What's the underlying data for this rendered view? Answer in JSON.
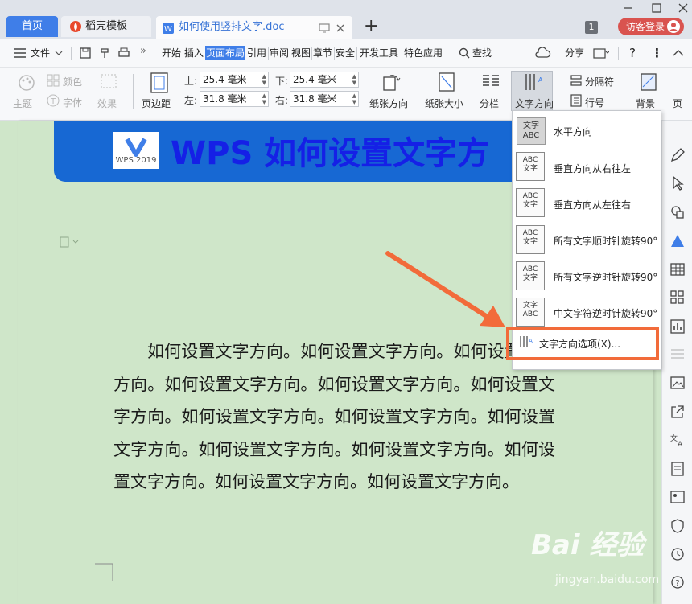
{
  "tabs": {
    "home": "首页",
    "template": "稻壳模板",
    "doc": "如何使用竖排文字.doc",
    "add": "+"
  },
  "window": {
    "badge": "1",
    "login": "访客登录"
  },
  "menu": {
    "file": "文件",
    "items": [
      "开始",
      "插入",
      "页面布局",
      "引用",
      "审阅",
      "视图",
      "章节",
      "安全",
      "开发工具",
      "特色应用"
    ],
    "search": "查找",
    "share": "分享",
    "help": "?"
  },
  "ribbon": {
    "theme": "主题",
    "color": "颜色",
    "font": "字体",
    "effect": "效果",
    "margin": "页边距",
    "top_label": "上:",
    "top_value": "25.4 毫米",
    "bottom_label": "下:",
    "bottom_value": "25.4 毫米",
    "left_label": "左:",
    "left_value": "31.8 毫米",
    "right_label": "右:",
    "right_value": "31.8 毫米",
    "orientation": "纸张方向",
    "size": "纸张大小",
    "columns": "分栏",
    "text_direction": "文字方向",
    "separator": "分隔符",
    "line_number": "行号",
    "background": "背景",
    "page": "页"
  },
  "document": {
    "logo_text": "WPS 2019",
    "banner_title": "WPS 如何设置文字方",
    "paragraph": "如何设置文字方向。如何设置文字方向。如何设置文字方向。如何设置文字方向。如何设置文字方向。如何设置文字方向。如何设置文字方向。如何设置文字方向。如何设置文字方向。如何设置文字方向。如何设置文字方向。如何设置文字方向。如何设置文字方向。如何设置文字方向。"
  },
  "dropdown": {
    "items": [
      {
        "label": "水平方向",
        "icon": "文字ABC"
      },
      {
        "label": "垂直方向从右往左",
        "icon": "ABC文字"
      },
      {
        "label": "垂直方向从左往右",
        "icon": "ABC文字"
      },
      {
        "label": "所有文字顺时针旋转90°",
        "icon": "ABC文字"
      },
      {
        "label": "所有文字逆时针旋转90°",
        "icon": "ABC文字"
      },
      {
        "label": "中文字符逆时针旋转90°",
        "icon": "文字ABC"
      }
    ],
    "options": "文字方向选项(X)..."
  },
  "watermark": {
    "main": "Bai 经验",
    "sub": "jingyan.baidu.com"
  },
  "colors": {
    "accent": "#3f7ee8",
    "banner": "#1768d3",
    "highlight": "#f26b3a",
    "page": "#cfe6c9",
    "login": "#d9534f"
  }
}
